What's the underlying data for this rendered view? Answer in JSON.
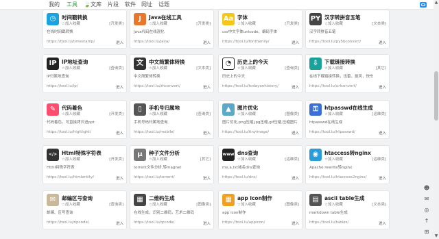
{
  "nav": {
    "items": [
      "我的",
      "工具",
      "文库",
      "片段",
      "软件",
      "网址",
      "话题"
    ],
    "active_index": 1
  },
  "fav_label": "☆加入收藏",
  "go_label": "进入",
  "cards": [
    {
      "title": "时间戳转换",
      "tag": "[开发类]",
      "desc": "在线时间戳转换",
      "url": "https://tool.lu/timestamp/",
      "icon": "clock-icon",
      "color": "#1ba3e0",
      "glyph": "◷"
    },
    {
      "title": "Java在线工具",
      "tag": "[开发类]",
      "desc": "Java代码在线混化",
      "url": "https://tool.lu/java/",
      "icon": "java-icon",
      "color": "#e8762d",
      "glyph": "J"
    },
    {
      "title": "字体",
      "tag": "[开发类]",
      "desc": "css中文字体unicode、编码字体",
      "url": "https://tool.lu/fontfamily/",
      "icon": "font-icon",
      "color": "#f5c518",
      "glyph": "Aa"
    },
    {
      "title": "汉字转拼音五笔",
      "tag": "[文本类]",
      "desc": "汉字转拼音五笔",
      "url": "https://tool.lu/py5bconvert/",
      "icon": "pinyin-icon",
      "color": "#444444",
      "glyph": "PY"
    },
    {
      "title": "IP地址查询",
      "tag": "[查询类]",
      "desc": "IP归属地查询",
      "url": "https://tool.lu/ip/",
      "icon": "location-pin-icon",
      "color": "#222222",
      "glyph": "IP"
    },
    {
      "title": "中文简繁体转换",
      "tag": "[文本类]",
      "desc": "中文简繁体转换",
      "url": "https://tool.lu/zhconvert/",
      "icon": "translate-icon",
      "color": "#333333",
      "glyph": "文"
    },
    {
      "title": "历史上的今天",
      "tag": "[查询类]",
      "desc": "历史上的今天",
      "url": "https://tool.lu/todayonhistory/",
      "icon": "history-clock-icon",
      "color": "#ffffff",
      "glyph": "◔"
    },
    {
      "title": "下载链接转换",
      "tag": "[其它]",
      "desc": "在线下载链接转换，迅雷，旋风，快车",
      "url": "https://tool.lu/urlconvert/",
      "icon": "download-icon",
      "color": "#1aa39a",
      "glyph": "⇩"
    },
    {
      "title": "代码着色",
      "tag": "[开发类]",
      "desc": "代码着色，可直接拷贝进ppt",
      "url": "https://tool.lu/highlight/",
      "icon": "highlighter-icon",
      "color": "#ff4d6d",
      "glyph": "✎"
    },
    {
      "title": "手机号归属地",
      "tag": "[查询类]",
      "desc": "手机号码归属地查询",
      "url": "https://tool.lu/mobile/",
      "icon": "phone-icon",
      "color": "#555555",
      "glyph": "▯"
    },
    {
      "title": "图片优化",
      "tag": "[图像类]",
      "desc": "图片优化,png压缩,jpg压缩,gif压缩,压缩图片",
      "url": "https://tool.lu/tinyimage/",
      "icon": "image-icon",
      "color": "#5aa9c9",
      "glyph": "▲"
    },
    {
      "title": "htpasswd在线生成",
      "tag": "[运维类]",
      "desc": "htpasswd在线生成",
      "url": "https://tool.lu/htpasswd/",
      "icon": "lock-icon",
      "color": "#3b6fd8",
      "glyph": "⚿"
    },
    {
      "title": "Html特殊字符表",
      "tag": "[开发类]",
      "desc": "Html特殊字符表",
      "url": "https://tool.lu/htmlentity/",
      "icon": "code-icon",
      "color": "#333333",
      "glyph": "</>"
    },
    {
      "title": "种子文件分析",
      "tag": "[其它]",
      "desc": "torrent文件分析,转magnet",
      "url": "https://tool.lu/torrent/",
      "icon": "torrent-icon",
      "color": "#777777",
      "glyph": "μ"
    },
    {
      "title": "dns查询",
      "tag": "[运维类]",
      "desc": "mx,a,txt域名dns查询",
      "url": "https://tool.lu/dns/",
      "icon": "www-icon",
      "color": "#222222",
      "glyph": "www"
    },
    {
      "title": "htaccess转nginx",
      "tag": "[运维类]",
      "desc": "Apache rewrite转nginx",
      "url": "https://tool.lu/htaccess2nginx/",
      "icon": "map-pin-icon",
      "color": "#2a9dd9",
      "glyph": "◉"
    },
    {
      "title": "邮编区号查询",
      "tag": "[查询类]",
      "desc": "邮编、区号查询",
      "url": "https://tool.lu/zipcode/",
      "icon": "envelope-icon",
      "color": "#c8b99a",
      "glyph": "✉"
    },
    {
      "title": "二维码生成",
      "tag": "[图像类]",
      "desc": "在线生成，识别二维码，艺术二维码",
      "url": "https://tool.lu/qrcode/",
      "icon": "qrcode-icon",
      "color": "#444444",
      "glyph": "▦"
    },
    {
      "title": "app icon制作",
      "tag": "[图像类]",
      "desc": "app icon制作",
      "url": "https://tool.lu/appicon/",
      "icon": "app-grid-icon",
      "color": "#f0a020",
      "glyph": "▦"
    },
    {
      "title": "ascii table生成",
      "tag": "[文本类]",
      "desc": "markdown table生成",
      "url": "https://tool.lu/tables/",
      "icon": "table-icon",
      "color": "#555555",
      "glyph": "▤"
    }
  ]
}
